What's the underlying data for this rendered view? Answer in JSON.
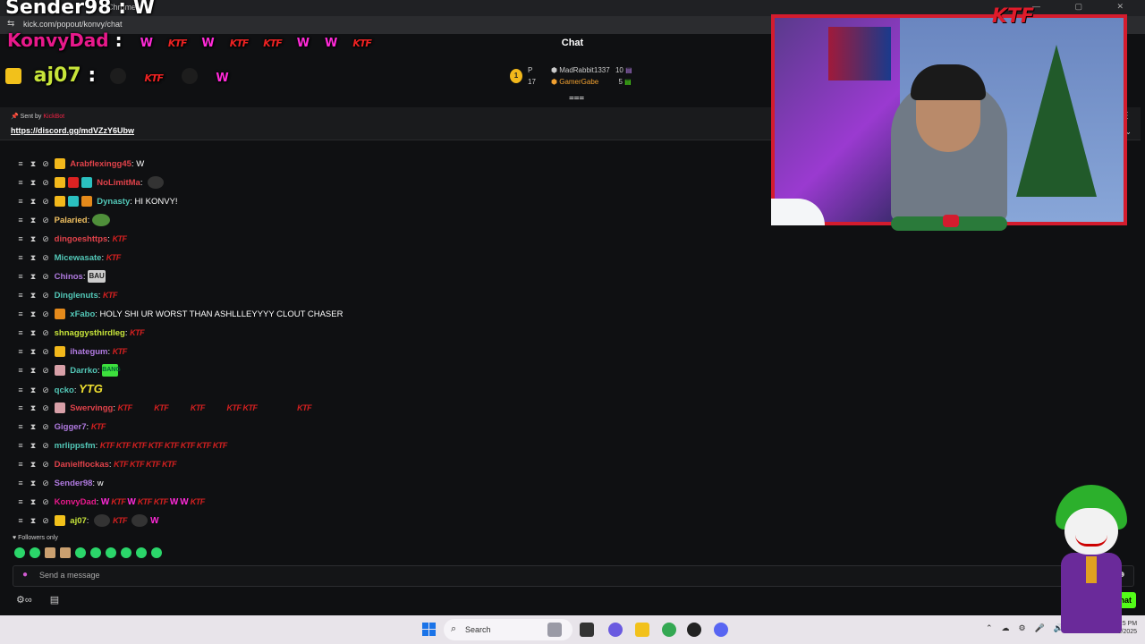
{
  "browser": {
    "tab_title": "Chrome",
    "url": "kick.com/popout/konvy/chat",
    "window_controls": "— ▢ ✕"
  },
  "overlay": {
    "sender_line": {
      "user": "Sender98",
      "sep": ":",
      "text": "W"
    },
    "konvy_line": {
      "user": "KonvyDad",
      "sep": ":"
    },
    "aj_line": {
      "user": "aj07",
      "sep": ":"
    },
    "emote_w": "W",
    "emote_ktf": "KTF"
  },
  "chat": {
    "title": "Chat",
    "leaderboard": {
      "rank_badge": "1",
      "p_label": "P",
      "p_count": "17",
      "entries": [
        {
          "user": "MadRabbit1337",
          "count": "10"
        },
        {
          "user": "GamerGabe",
          "count": "5"
        }
      ]
    },
    "pinned": {
      "sent_by_label": "Sent by",
      "sent_by_user": "KickBot",
      "link": "https://discord.gg/mdVZzY6Ubw"
    },
    "messages": [
      {
        "user": "Arabflexingg45",
        "color": "#e0424a",
        "text": "W",
        "badges": [
          "crown"
        ]
      },
      {
        "user": "NoLimitMa",
        "color": "#53c8b8",
        "text": "",
        "badges": [
          "crown",
          "red",
          "teal"
        ]
      },
      {
        "user": "Dynasty",
        "color": "#53c8b8",
        "text": "HI KONVY!",
        "badges": [
          "crown",
          "teal",
          "shirt"
        ]
      },
      {
        "user": "Palaried",
        "color": "#f0c060",
        "text": "",
        "badges": []
      },
      {
        "user": "dingoeshttps",
        "color": "#e0424a",
        "text": "",
        "badges": []
      },
      {
        "user": "Micewasate",
        "color": "#53c8b8",
        "text": "",
        "badges": []
      },
      {
        "user": "Chinos",
        "color": "#b07ae0",
        "text": "",
        "badges": []
      },
      {
        "user": "Dinglenuts",
        "color": "#53c8b8",
        "text": "",
        "badges": []
      },
      {
        "user": "xFabo",
        "color": "#53c8b8",
        "text": "HOLY SHI UR WORST THAN ASHLLLEYYYY CLOUT CHASER",
        "badges": [
          "shirt"
        ]
      },
      {
        "user": "shnaggysthirdleg",
        "color": "#c7e43a",
        "text": "",
        "badges": []
      },
      {
        "user": "ihategum",
        "color": "#b07ae0",
        "text": "",
        "badges": [
          "crown"
        ]
      },
      {
        "user": "Darrko",
        "color": "#53c8b8",
        "text": "",
        "badges": [
          "ptrn"
        ]
      },
      {
        "user": "qcko",
        "color": "#53c8b8",
        "text": "",
        "badges": []
      },
      {
        "user": "Swervingg",
        "color": "#e0424a",
        "text": "",
        "badges": [
          "ptrn"
        ]
      },
      {
        "user": "Gigger7",
        "color": "#b07ae0",
        "text": "",
        "badges": []
      },
      {
        "user": "mrlippsfm",
        "color": "#53c8b8",
        "text": "",
        "badges": []
      },
      {
        "user": "Danielflockas",
        "color": "#e0424a",
        "text": "",
        "badges": []
      },
      {
        "user": "Sender98",
        "color": "#b07ae0",
        "text": "w",
        "badges": []
      },
      {
        "user": "KonvyDad",
        "color": "#e8198b",
        "text": "",
        "badges": []
      },
      {
        "user": "aj07",
        "color": "#c7e43a",
        "text": "",
        "badges": [
          "yellow"
        ]
      }
    ],
    "emote_texts": {
      "bau": "BAU",
      "bang": "BANG",
      "ytg": "YTG"
    },
    "followers_only": "Followers only",
    "input_placeholder": "Send a message",
    "chat_button": "Chat"
  },
  "webcam": {
    "frame_title": "KTF"
  },
  "taskbar": {
    "search_label": "Search",
    "time": "7:25 PM",
    "date": "12/21/2025"
  },
  "colors": {
    "kick_green": "#53fc18",
    "bg": "#0f1012",
    "ktf_red": "#d42020",
    "w_pink": "#ff2ad8"
  }
}
